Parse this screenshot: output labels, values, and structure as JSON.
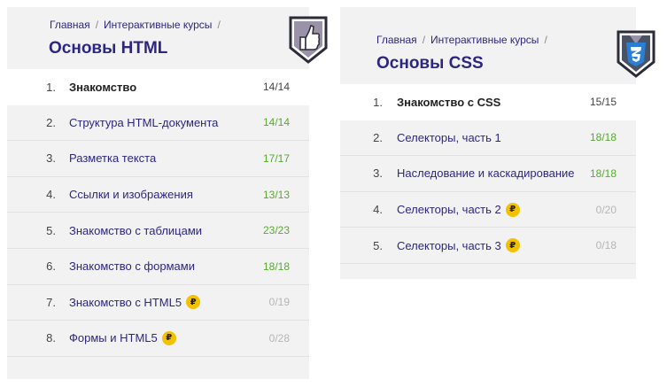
{
  "breadcrumbs": [
    "Главная",
    "Интерактивные курсы"
  ],
  "courses": [
    {
      "id": "html",
      "title": "Основы HTML",
      "badge_icon": "thumbs-up-icon",
      "lessons": [
        {
          "num": "1.",
          "name": "Знакомство",
          "score": "14/14",
          "paid": false,
          "state": "active"
        },
        {
          "num": "2.",
          "name": "Структура HTML-документа",
          "score": "14/14",
          "paid": false,
          "state": "done"
        },
        {
          "num": "3.",
          "name": "Разметка текста",
          "score": "17/17",
          "paid": false,
          "state": "done"
        },
        {
          "num": "4.",
          "name": "Ссылки и изображения",
          "score": "13/13",
          "paid": false,
          "state": "done"
        },
        {
          "num": "5.",
          "name": "Знакомство с таблицами",
          "score": "23/23",
          "paid": false,
          "state": "done"
        },
        {
          "num": "6.",
          "name": "Знакомство с формами",
          "score": "18/18",
          "paid": false,
          "state": "done"
        },
        {
          "num": "7.",
          "name": "Знакомство с HTML5",
          "score": "0/19",
          "paid": true,
          "state": "none"
        },
        {
          "num": "8.",
          "name": "Формы и HTML5",
          "score": "0/28",
          "paid": true,
          "state": "none"
        }
      ]
    },
    {
      "id": "css",
      "title": "Основы CSS",
      "badge_icon": "css3-shield-icon",
      "lessons": [
        {
          "num": "1.",
          "name": "Знакомство с CSS",
          "score": "15/15",
          "paid": false,
          "state": "active"
        },
        {
          "num": "2.",
          "name": "Селекторы, часть 1",
          "score": "18/18",
          "paid": false,
          "state": "done"
        },
        {
          "num": "3.",
          "name": "Наследование и каскадирование",
          "score": "18/18",
          "paid": false,
          "state": "done"
        },
        {
          "num": "4.",
          "name": "Селекторы, часть 2",
          "score": "0/20",
          "paid": true,
          "state": "none"
        },
        {
          "num": "5.",
          "name": "Селекторы, часть 3",
          "score": "0/18",
          "paid": true,
          "state": "none"
        }
      ]
    }
  ],
  "paid_symbol": "₽",
  "colors": {
    "accent": "#2c2680",
    "done": "#59a832",
    "pending": "#b6b6b6",
    "coin": "#f2c200",
    "card_bg": "#f2f2f2"
  }
}
